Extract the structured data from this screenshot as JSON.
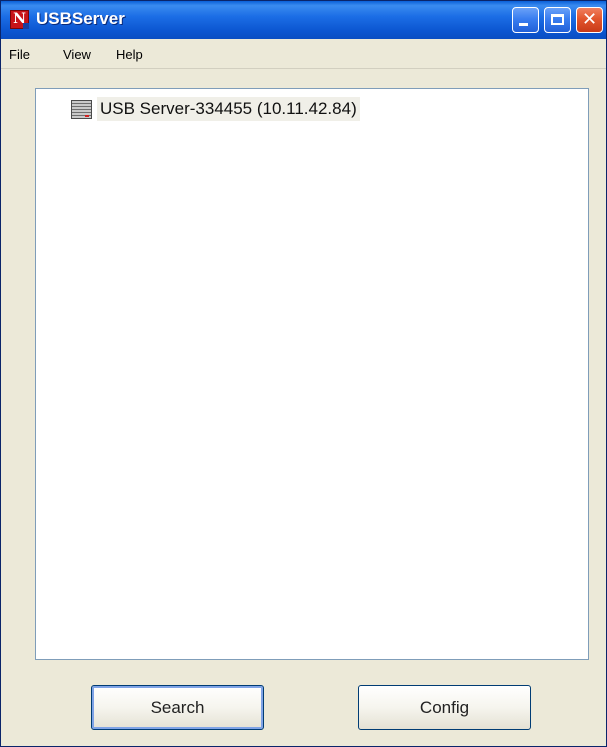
{
  "window": {
    "title": "USBServer",
    "icon": "app-n-icon"
  },
  "menu": [
    "File",
    "View",
    "Help"
  ],
  "tree": {
    "nodes": [
      {
        "label": "USB Server-334455 (10.11.42.84)",
        "icon": "server-icon"
      }
    ]
  },
  "buttons": {
    "search": "Search",
    "config": "Config"
  },
  "colors": {
    "titlebar": "#0b55d0",
    "close_button": "#e2562e",
    "face": "#ece9d8"
  }
}
